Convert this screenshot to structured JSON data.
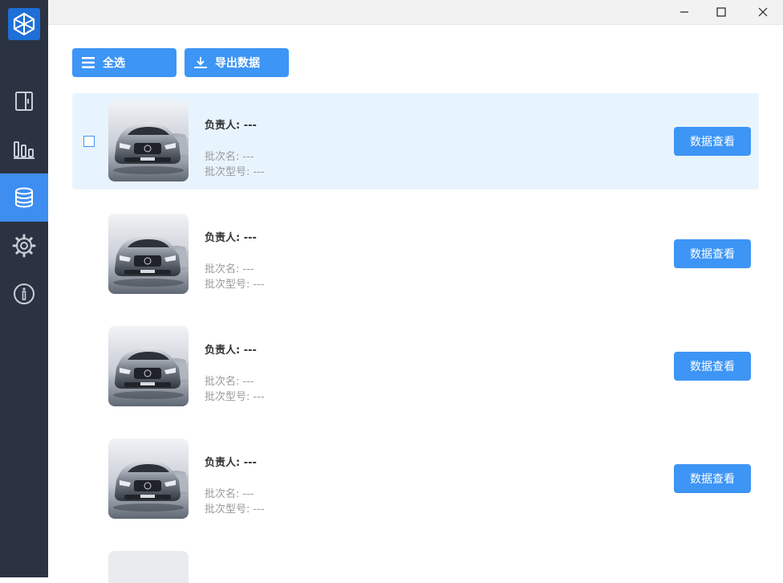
{
  "toolbar": {
    "select_all_label": "全选",
    "export_label": "导出数据"
  },
  "items": [
    {
      "owner": "负责人: ---",
      "batch_name": "批次名: ---",
      "batch_model": "批次型号: ---",
      "action_label": "数据查看",
      "selected": true
    },
    {
      "owner": "负责人: ---",
      "batch_name": "批次名: ---",
      "batch_model": "批次型号: ---",
      "action_label": "数据查看",
      "selected": false
    },
    {
      "owner": "负责人: ---",
      "batch_name": "批次名: ---",
      "batch_model": "批次型号: ---",
      "action_label": "数据查看",
      "selected": false
    },
    {
      "owner": "负责人: ---",
      "batch_name": "批次名: ---",
      "batch_model": "批次型号: ---",
      "action_label": "数据查看",
      "selected": false
    }
  ],
  "sidebar": {
    "items": [
      {
        "icon": "panel-icon"
      },
      {
        "icon": "bar-chart-icon"
      },
      {
        "icon": "database-icon",
        "active": true
      },
      {
        "icon": "gear-icon"
      },
      {
        "icon": "info-icon"
      }
    ]
  },
  "colors": {
    "sidebar": "#2b3342",
    "accent": "#3d95f5",
    "selected_row": "#e8f4fd"
  }
}
